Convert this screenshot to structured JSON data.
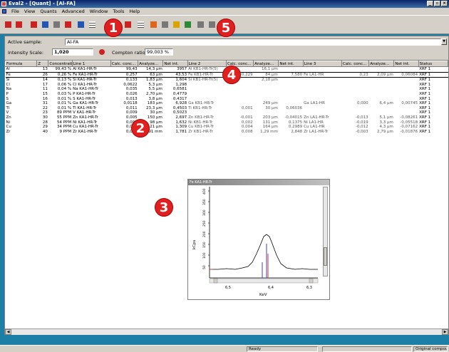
{
  "window": {
    "title": "Eval2 - [Quant] - [Al-FA]"
  },
  "menu": [
    "File",
    "View",
    "Quants",
    "Advanced",
    "Window",
    "Tools",
    "Help"
  ],
  "callouts": [
    "1",
    "2",
    "3",
    "4",
    "5"
  ],
  "toolbar": {
    "icons": [
      "open-icon",
      "save-icon",
      "element-icon",
      "chart-icon",
      "calibrate-icon",
      "measure-icon",
      "report-icon",
      "table-icon",
      "list-icon",
      "sort-icon",
      "spectrum-icon",
      "peaks-icon",
      "copy-icon",
      "print-icon"
    ]
  },
  "sample": {
    "active_label": "Active sample:",
    "active_value": "Al-FA",
    "intensity_label": "Intensity Scale:",
    "intensity_value": "1,020",
    "compton_label": "Compton ratio:",
    "compton_value": "99,003 %"
  },
  "table": {
    "columns": [
      "Formula",
      "Z",
      "Concentrati...",
      "Line 1",
      "Calc. conc...",
      "Analyze...",
      "Net int.",
      "Line 2",
      "Calc. conc...",
      "Analyze...",
      "Net int.",
      "Line 3",
      "Calc. conc...",
      "Analyze...",
      "Net int.",
      "Status"
    ],
    "rows": [
      [
        "Al",
        "13",
        "99,43 %",
        "Al KA1-HR-Tr",
        "99,43",
        "14,3 µm",
        "3957",
        "Al KB1-HR-Tr(5)",
        "",
        "16,1 µm",
        "",
        "",
        "",
        "",
        "",
        "XRF 1"
      ],
      [
        "Fe",
        "26",
        "0,26 %",
        "Fe KA1-HR-Tr",
        "0,257",
        "63 µm",
        "43,53",
        "Fe KB1-HR-Tr",
        "0,229",
        "84 µm",
        "7,580",
        "Fe LA1-HR",
        "0,23",
        "2,09 µm",
        "0,06084",
        "XRF 1"
      ],
      [
        "Si",
        "14",
        "0,13 %",
        "Si KA1-HR-Tr",
        "0,133",
        "1,83 µm",
        "1,604",
        "Si KB1-HR-Tr(5)",
        "",
        "2,18 µm",
        "",
        "",
        "",
        "",
        "",
        "XRF 1"
      ],
      [
        "Cl",
        "17",
        "0,06 %",
        "Cl KA1-HR-Tr",
        "0,0622",
        "5,3 µm",
        "1,298",
        "",
        "",
        "",
        "",
        "",
        "",
        "",
        "",
        "XRF 1"
      ],
      [
        "Na",
        "11",
        "0,04 %",
        "Na KA1-HR-Tr",
        "0,035",
        "5,5 µm",
        "0,6581",
        "",
        "",
        "",
        "",
        "",
        "",
        "",
        "",
        "XRF 1"
      ],
      [
        "P",
        "15",
        "0,03 %",
        "P KA1-HR-Tr",
        "0,026",
        "2,70 µm",
        "0,4779",
        "",
        "",
        "",
        "",
        "",
        "",
        "",
        "",
        "XRF 1"
      ],
      [
        "S",
        "16",
        "0,01 %",
        "S KA1-HR-Tr",
        "0,013",
        "3,8 µm",
        "0,4317",
        "",
        "",
        "",
        "",
        "",
        "",
        "",
        "",
        "XRF 1"
      ],
      [
        "Ga",
        "31",
        "0,01 %",
        "Ga KA1-HR-Tr",
        "0,0118",
        "183 µm",
        "6,928",
        "Ga KB1-HR-Tr",
        "",
        "249 µm",
        "",
        "Ga LA1-HR",
        "0,000",
        "6,4 µm",
        "0,00745",
        "XRF 1"
      ],
      [
        "Ti",
        "22",
        "0,01 %",
        "Ti KA1-HR-Tr",
        "0,011",
        "23,3 µm",
        "0,4503",
        "Ti KB1-HR-Tr",
        "0,001",
        "30 µm",
        "0,06036",
        "",
        "",
        "",
        "",
        "XRF 1"
      ],
      [
        "V",
        "23",
        "89 PPM",
        "V KA1-HR-Tr",
        "0,009",
        "30 µm",
        "0,5023",
        "",
        "",
        "",
        "",
        "",
        "",
        "",
        "",
        "XRF 1"
      ],
      [
        "Zn",
        "30",
        "55 PPM",
        "Zn KA1-HR-Tr",
        "0,005",
        "150 µm",
        "2,697",
        "Zn KB1-HR-Tr",
        "-0,001",
        "203 µm",
        "-0,04015",
        "Zn LA1-HR-Tr",
        "-0,013",
        "5,1 µm",
        "-0,08261",
        "XRF 1"
      ],
      [
        "Ni",
        "28",
        "54 PPM",
        "Ni KA1-HR-Tr",
        "0,005",
        "98 µm",
        "1,632",
        "Ni KB1-HR-Tr",
        "0,002",
        "131 µm",
        "0,1375",
        "Ni LA1-HR",
        "-0,019",
        "3,3 µm",
        "-0,05518",
        "XRF 1"
      ],
      [
        "Cu",
        "29",
        "34 PPM",
        "Cu KA1-HR-Tr",
        "0,003",
        "121 µm",
        "1,309",
        "Cu KB1-HR-Tr",
        "0,004",
        "164 µm",
        "0,2989",
        "Cu LA1-HR",
        "-0,012",
        "4,3 µm",
        "-0,07162",
        "XRF 1"
      ],
      [
        "Zr",
        "40",
        "9 PPM",
        "Zr KA1-HR-Tr",
        "0,001",
        "0,91 mm",
        "1,781",
        "Zr KB1-HR-Tr",
        "0,008",
        "1,29 mm",
        "2,848",
        "Zr LA1-HR-Tr",
        "-0,003",
        "2,79 µm",
        "-0,01876",
        "XRF 1"
      ]
    ]
  },
  "spectrum": {
    "title": "Fe KA1-HR-Tr",
    "ylabel": "kCps",
    "xlabel": "KeV",
    "y_ticks": [
      "400",
      "350",
      "300",
      "250",
      "200",
      "150",
      "100",
      "50"
    ],
    "x_ticks": [
      "6,5",
      "6,4",
      "6,3"
    ]
  },
  "status": {
    "ready": "Ready",
    "mode": "Original compounds"
  }
}
